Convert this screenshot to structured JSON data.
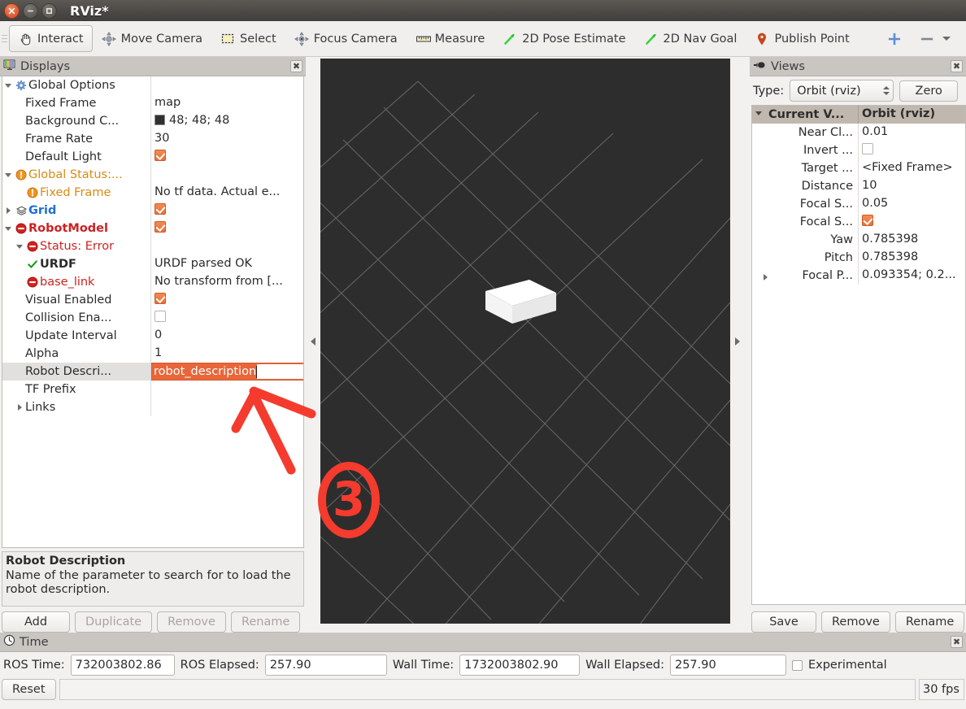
{
  "window": {
    "title": "RViz*",
    "controls": [
      "close",
      "minimize",
      "maximize"
    ]
  },
  "toolbar": {
    "items": [
      {
        "label": "Interact",
        "icon": "hand-cursor-icon",
        "checked": true
      },
      {
        "label": "Move Camera",
        "icon": "move-camera-icon",
        "checked": false
      },
      {
        "label": "Select",
        "icon": "select-rect-icon",
        "checked": false
      },
      {
        "label": "Focus Camera",
        "icon": "focus-camera-icon",
        "checked": false
      },
      {
        "label": "Measure",
        "icon": "ruler-icon",
        "checked": false
      },
      {
        "label": "2D Pose Estimate",
        "icon": "green-arrow-icon",
        "checked": false
      },
      {
        "label": "2D Nav Goal",
        "icon": "green-arrow-icon",
        "checked": false
      },
      {
        "label": "Publish Point",
        "icon": "map-pin-icon",
        "checked": false
      }
    ],
    "tool_add": "plus-icon",
    "tool_remove": "minus-icon",
    "tool_visibility": "eye-icon"
  },
  "displays": {
    "title": "Displays",
    "title_icon": "displays-monitor-icon",
    "close_icon": "close-icon",
    "rows": [
      {
        "indent": 0,
        "twisty": "down",
        "icon": "gear-icon",
        "label": "Global Options",
        "style": "plain",
        "value": "",
        "value_kind": "text"
      },
      {
        "indent": 1,
        "twisty": "none",
        "icon": "none",
        "label": "Fixed Frame",
        "style": "plain",
        "value": "map",
        "value_kind": "text"
      },
      {
        "indent": 1,
        "twisty": "none",
        "icon": "none",
        "label": "Background C...",
        "style": "plain",
        "value": "48; 48; 48",
        "value_kind": "color",
        "swatch": "#303030"
      },
      {
        "indent": 1,
        "twisty": "none",
        "icon": "none",
        "label": "Frame Rate",
        "style": "plain",
        "value": "30",
        "value_kind": "text"
      },
      {
        "indent": 1,
        "twisty": "none",
        "icon": "none",
        "label": "Default Light",
        "style": "plain",
        "value": "",
        "value_kind": "checked"
      },
      {
        "indent": 0,
        "twisty": "down",
        "icon": "warn-icon",
        "label": "Global Status:...",
        "style": "orange",
        "value": "",
        "value_kind": "text"
      },
      {
        "indent": 1,
        "twisty": "none",
        "icon": "warn-icon",
        "label": "Fixed Frame",
        "style": "orange",
        "value": "No tf data.  Actual e...",
        "value_kind": "text"
      },
      {
        "indent": 0,
        "twisty": "right",
        "icon": "grid-icon",
        "label": "Grid",
        "style": "blue",
        "value": "",
        "value_kind": "checked"
      },
      {
        "indent": 0,
        "twisty": "down",
        "icon": "error-icon",
        "label": "RobotModel",
        "style": "red",
        "value": "",
        "value_kind": "checked"
      },
      {
        "indent": 1,
        "twisty": "down",
        "icon": "error-icon",
        "label": "Status: Error",
        "style": "redplain",
        "value": "",
        "value_kind": "text"
      },
      {
        "indent": 2,
        "twisty": "none",
        "icon": "check-icon",
        "label": "URDF",
        "style": "bold",
        "value": "URDF parsed OK",
        "value_kind": "text"
      },
      {
        "indent": 2,
        "twisty": "none",
        "icon": "error-icon",
        "label": "base_link",
        "style": "redplain",
        "value": "No transform from [...",
        "value_kind": "text"
      },
      {
        "indent": 1,
        "twisty": "none",
        "icon": "none",
        "label": "Visual Enabled",
        "style": "plain",
        "value": "",
        "value_kind": "checked"
      },
      {
        "indent": 1,
        "twisty": "none",
        "icon": "none",
        "label": "Collision Ena...",
        "style": "plain",
        "value": "",
        "value_kind": "unchecked"
      },
      {
        "indent": 1,
        "twisty": "none",
        "icon": "none",
        "label": "Update Interval",
        "style": "plain",
        "value": "0",
        "value_kind": "text"
      },
      {
        "indent": 1,
        "twisty": "none",
        "icon": "none",
        "label": "Alpha",
        "style": "plain",
        "value": "1",
        "value_kind": "text"
      },
      {
        "indent": 1,
        "twisty": "none",
        "icon": "none",
        "label": "Robot Descri...",
        "style": "plain",
        "value": "robot_description",
        "value_kind": "editing",
        "selected": true
      },
      {
        "indent": 1,
        "twisty": "none",
        "icon": "none",
        "label": "TF Prefix",
        "style": "plain",
        "value": "",
        "value_kind": "text"
      },
      {
        "indent": 1,
        "twisty": "right",
        "icon": "none",
        "label": "Links",
        "style": "plain",
        "value": "",
        "value_kind": "text"
      }
    ],
    "help": {
      "title": "Robot Description",
      "body": "Name of the parameter to search for to load the robot description."
    },
    "buttons": [
      {
        "label": "Add",
        "enabled": true
      },
      {
        "label": "Duplicate",
        "enabled": false
      },
      {
        "label": "Remove",
        "enabled": false
      },
      {
        "label": "Rename",
        "enabled": false
      }
    ]
  },
  "views": {
    "title": "Views",
    "title_icon": "camera-icon",
    "close_icon": "close-icon",
    "type_label": "Type:",
    "type_value": "Orbit (rviz)",
    "zero_button": "Zero",
    "header": {
      "name": "Current V...",
      "value": "Orbit (rviz)"
    },
    "rows": [
      {
        "name": "Near Cl...",
        "value": "0.01",
        "kind": "text",
        "twisty": "none"
      },
      {
        "name": "Invert ...",
        "value": "",
        "kind": "unchecked",
        "twisty": "none"
      },
      {
        "name": "Target ...",
        "value": "<Fixed Frame>",
        "kind": "text",
        "twisty": "none"
      },
      {
        "name": "Distance",
        "value": "10",
        "kind": "text",
        "twisty": "none"
      },
      {
        "name": "Focal S...",
        "value": "0.05",
        "kind": "text",
        "twisty": "none"
      },
      {
        "name": "Focal S...",
        "value": "",
        "kind": "checked",
        "twisty": "none"
      },
      {
        "name": "Yaw",
        "value": "0.785398",
        "kind": "text",
        "twisty": "none"
      },
      {
        "name": "Pitch",
        "value": "0.785398",
        "kind": "text",
        "twisty": "none"
      },
      {
        "name": "Focal P...",
        "value": "0.093354; 0.2...",
        "kind": "text",
        "twisty": "right"
      }
    ],
    "buttons": [
      {
        "label": "Save",
        "enabled": true
      },
      {
        "label": "Remove",
        "enabled": true
      },
      {
        "label": "Rename",
        "enabled": true
      }
    ]
  },
  "time": {
    "title": "Time",
    "title_icon": "clock-icon",
    "close_icon": "close-icon",
    "fields": [
      {
        "label": "ROS Time:",
        "value": "732003802.86"
      },
      {
        "label": "ROS Elapsed:",
        "value": "257.90"
      },
      {
        "label": "Wall Time:",
        "value": "1732003802.90"
      },
      {
        "label": "Wall Elapsed:",
        "value": "257.90"
      }
    ],
    "experimental_label": "Experimental",
    "experimental_checked": false,
    "reset_button": "Reset",
    "status_text": "",
    "fps": "30 fps"
  },
  "viewport": {
    "background_color": "#2d2d2d",
    "grid_color": "#8a8a8a",
    "robot_color": "#ffffff",
    "description": "3D grid ground plane in perspective with a single white box-shaped robot link"
  },
  "annotation": {
    "step_number": "3",
    "color": "#f43b2e",
    "description": "red hand-drawn arrow pointing to the Robot Description field and a circled step number"
  }
}
